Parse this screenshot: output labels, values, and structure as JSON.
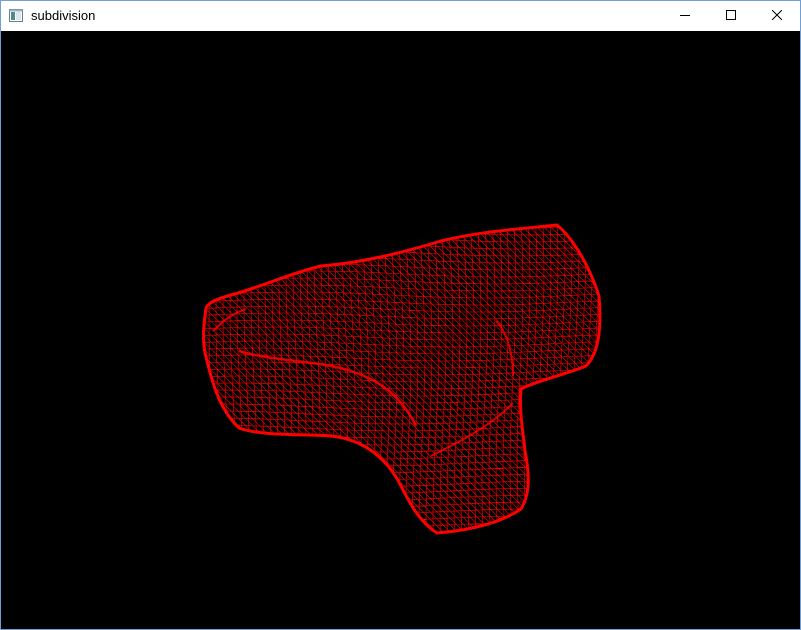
{
  "window": {
    "title": "subdivision",
    "icon": "app-window-icon",
    "controls": {
      "minimize": "minimize-icon",
      "maximize": "maximize-icon",
      "close": "close-icon"
    }
  },
  "viewport": {
    "background": "#000000",
    "render_mode": "wireframe",
    "mesh_color": "#ff0000",
    "object": "subdivided-t-shaped-mesh"
  }
}
